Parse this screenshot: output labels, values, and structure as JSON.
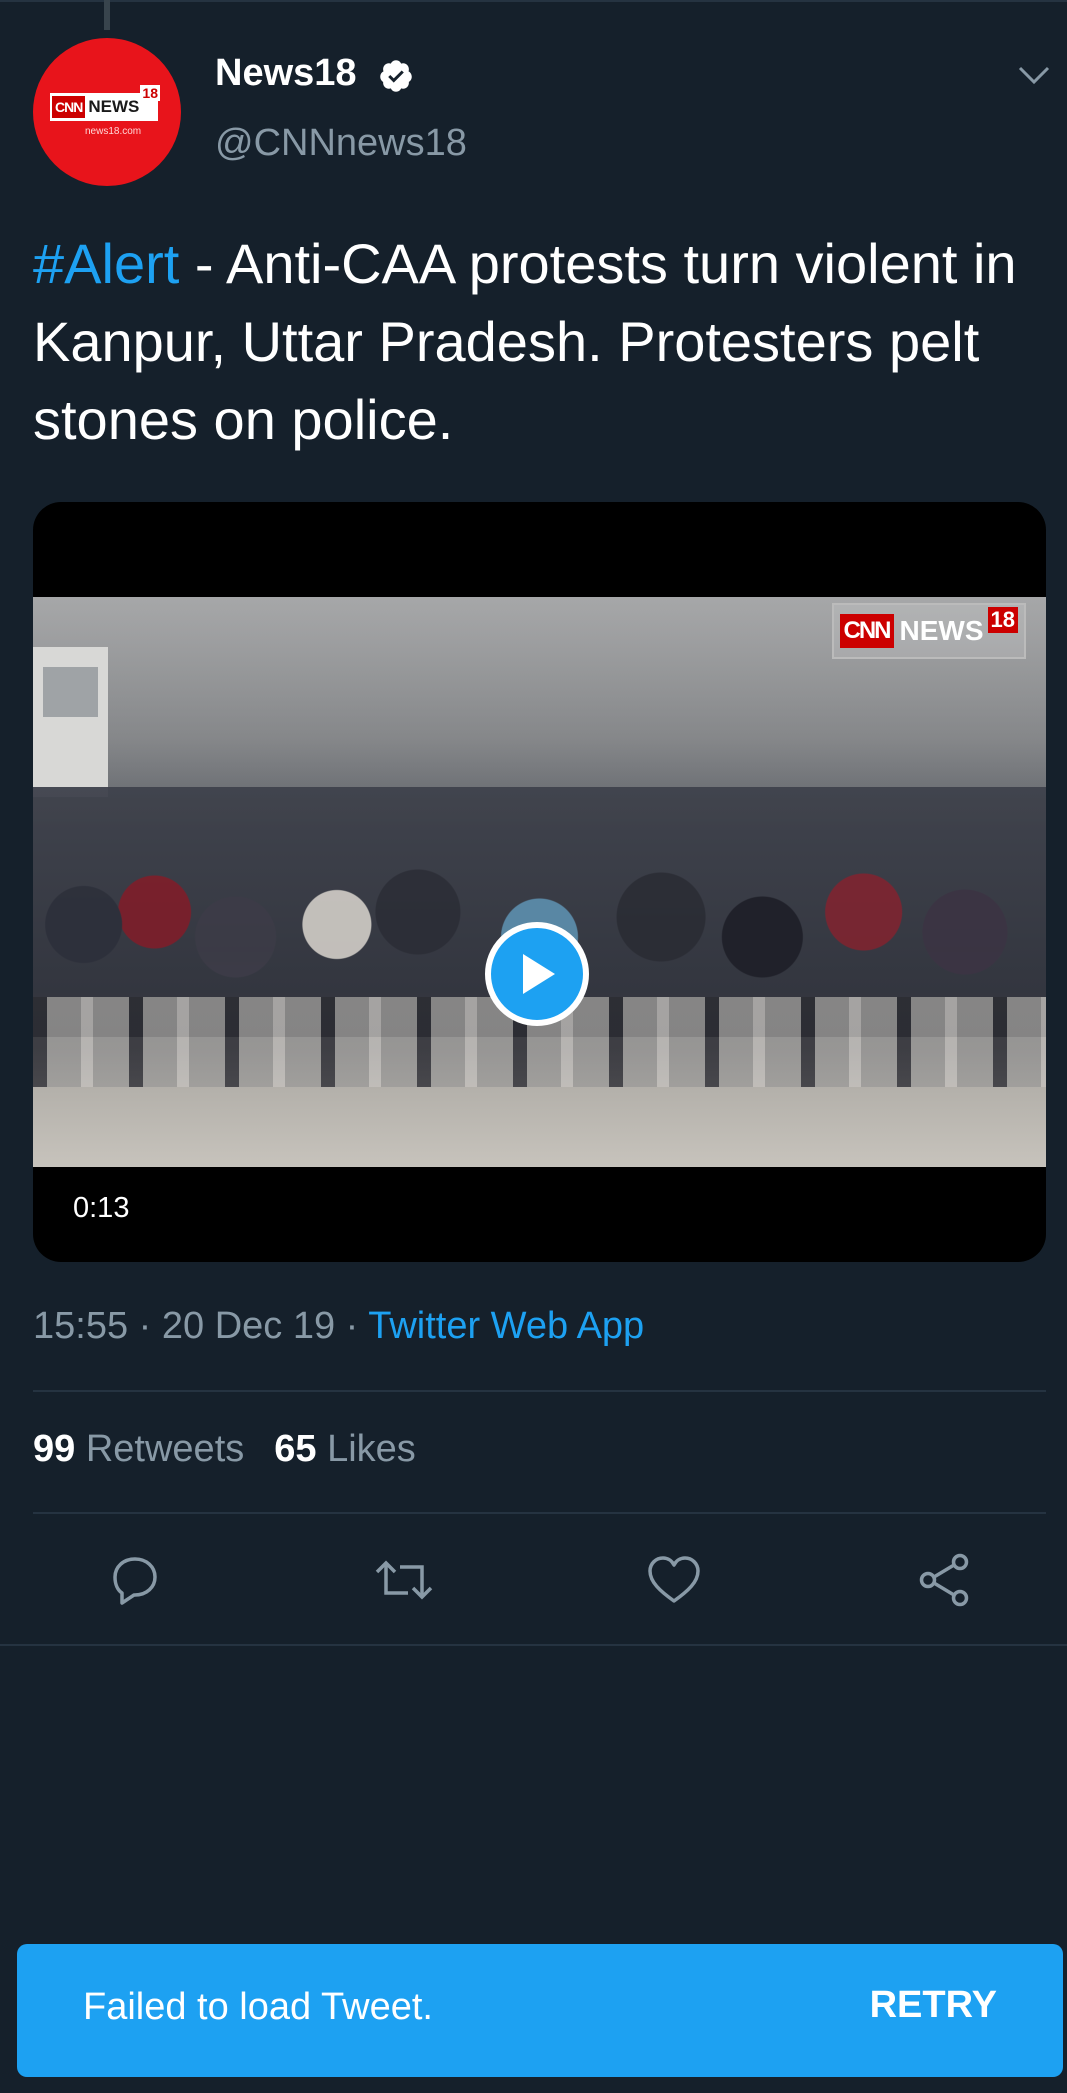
{
  "tweet": {
    "author_name": "News18",
    "author_handle": "@CNNnews18",
    "avatar_logo": {
      "cnn": "CNN",
      "news": "NEWS",
      "number": "18",
      "url": "news18.com"
    },
    "hashtag": "#Alert",
    "text": " - Anti-CAA protests turn violent in Kanpur, Uttar Pradesh. Protesters pelt stones on police.",
    "media": {
      "watermark": {
        "cnn": "CNN",
        "news": "NEWS",
        "number": "18"
      },
      "duration": "0:13"
    },
    "time": "15:55",
    "date": "20 Dec 19",
    "separator": "·",
    "source": "Twitter Web App",
    "retweet_count": "99",
    "retweet_label": "Retweets",
    "like_count": "65",
    "like_label": "Likes"
  },
  "actions": {
    "reply_icon": "reply-icon",
    "retweet_icon": "retweet-icon",
    "like_icon": "heart-icon",
    "share_icon": "share-icon"
  },
  "toast": {
    "message": "Failed to load Tweet.",
    "retry_label": "RETRY"
  },
  "colors": {
    "background": "#15202b",
    "accent": "#1da1f2",
    "secondary_text": "#8899a6",
    "divider": "#253341",
    "avatar_red": "#e8141b"
  }
}
